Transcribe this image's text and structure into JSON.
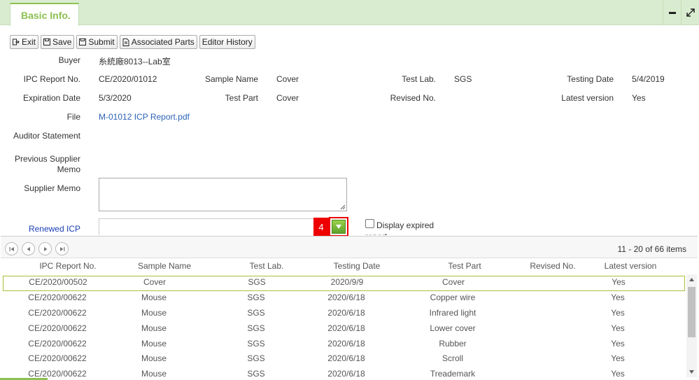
{
  "header": {
    "tab_label": "Basic Info."
  },
  "toolbar": {
    "exit": "Exit",
    "save": "Save",
    "submit": "Submit",
    "associated_parts": "Associated Parts",
    "editor_history": "Editor History"
  },
  "form": {
    "buyer_label": "Buyer",
    "buyer_value": "糸統廠8013--Lab室",
    "ipc_report_no_label": "IPC Report No.",
    "ipc_report_no_value": "CE/2020/01012",
    "sample_name_label": "Sample Name",
    "sample_name_value": "Cover",
    "test_lab_label": "Test Lab.",
    "test_lab_value": "SGS",
    "testing_date_label": "Testing Date",
    "testing_date_value": "5/4/2019",
    "expiration_date_label": "Expiration Date",
    "expiration_date_value": "5/3/2020",
    "test_part_label": "Test Part",
    "test_part_value": "Cover",
    "revised_no_label": "Revised No.",
    "revised_no_value": "",
    "latest_version_label": "Latest version",
    "latest_version_value": "Yes",
    "file_label": "File",
    "file_value": "M-01012 ICP Report.pdf",
    "auditor_statement_label": "Auditor Statement",
    "previous_supplier_memo_label_1": "Previous Supplier",
    "previous_supplier_memo_label_2": "Memo",
    "supplier_memo_label": "Supplier Memo",
    "supplier_memo_value": "",
    "renewed_icp_label": "Renewed ICP",
    "renewed_icp_value": "",
    "step_badge": "4",
    "display_expired_label_1": "Display expired",
    "display_expired_label_2": "report"
  },
  "pager": {
    "info": "11 - 20 of 66 items"
  },
  "grid": {
    "columns": [
      "IPC Report No.",
      "Sample Name",
      "Test Lab.",
      "Testing Date",
      "Test Part",
      "Revised No.",
      "Latest version"
    ],
    "rows": [
      [
        "CE/2020/00502",
        "Cover",
        "SGS",
        "2020/9/9",
        "Cover",
        "",
        "Yes"
      ],
      [
        "CE/2020/00622",
        "Mouse",
        "SGS",
        "2020/6/18",
        "Copper wire",
        "",
        "Yes"
      ],
      [
        "CE/2020/00622",
        "Mouse",
        "SGS",
        "2020/6/18",
        "Infrared light",
        "",
        "Yes"
      ],
      [
        "CE/2020/00622",
        "Mouse",
        "SGS",
        "2020/6/18",
        "Lower cover",
        "",
        "Yes"
      ],
      [
        "CE/2020/00622",
        "Mouse",
        "SGS",
        "2020/6/18",
        "Rubber",
        "",
        "Yes"
      ],
      [
        "CE/2020/00622",
        "Mouse",
        "SGS",
        "2020/6/18",
        "Scroll",
        "",
        "Yes"
      ],
      [
        "CE/2020/00622",
        "Mouse",
        "SGS",
        "2020/6/18",
        "Treademark",
        "",
        "Yes"
      ]
    ]
  },
  "colors": {
    "accent": "#8cc152",
    "header_bg": "#d9ecd0",
    "highlight": "#e00000",
    "link": "#2b63b5"
  }
}
